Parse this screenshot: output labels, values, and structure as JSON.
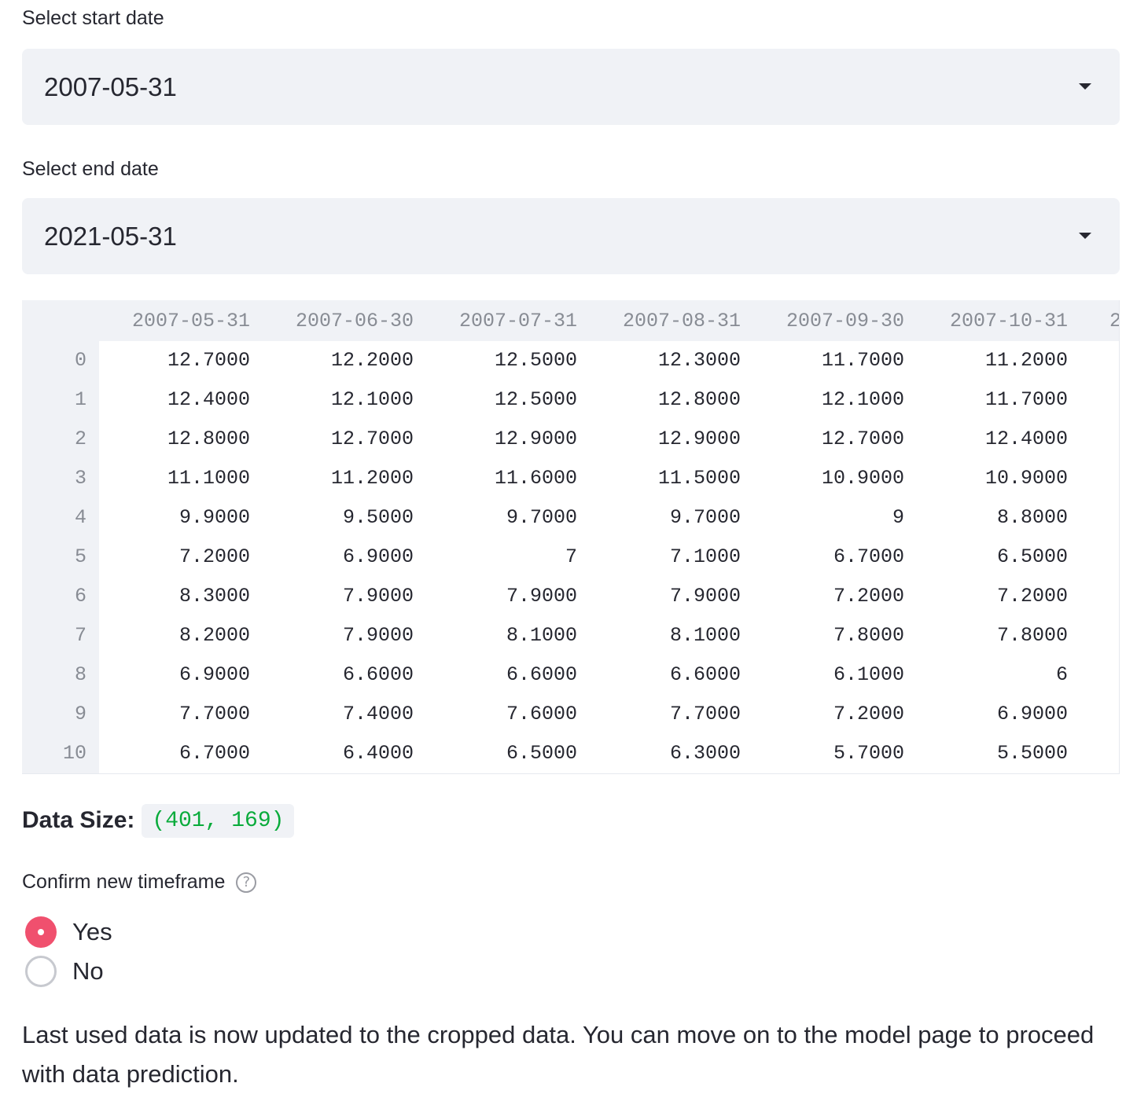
{
  "start_date": {
    "label": "Select start date",
    "value": "2007-05-31"
  },
  "end_date": {
    "label": "Select end date",
    "value": "2021-05-31"
  },
  "dataframe": {
    "columns": [
      "2007-05-31",
      "2007-06-30",
      "2007-07-31",
      "2007-08-31",
      "2007-09-30",
      "2007-10-31",
      "2"
    ],
    "index": [
      "0",
      "1",
      "2",
      "3",
      "4",
      "5",
      "6",
      "7",
      "8",
      "9",
      "10"
    ],
    "rows": [
      [
        "12.7000",
        "12.2000",
        "12.5000",
        "12.3000",
        "11.7000",
        "11.2000"
      ],
      [
        "12.4000",
        "12.1000",
        "12.5000",
        "12.8000",
        "12.1000",
        "11.7000"
      ],
      [
        "12.8000",
        "12.7000",
        "12.9000",
        "12.9000",
        "12.7000",
        "12.4000"
      ],
      [
        "11.1000",
        "11.2000",
        "11.6000",
        "11.5000",
        "10.9000",
        "10.9000"
      ],
      [
        "9.9000",
        "9.5000",
        "9.7000",
        "9.7000",
        "9",
        "8.8000"
      ],
      [
        "7.2000",
        "6.9000",
        "7",
        "7.1000",
        "6.7000",
        "6.5000"
      ],
      [
        "8.3000",
        "7.9000",
        "7.9000",
        "7.9000",
        "7.2000",
        "7.2000"
      ],
      [
        "8.2000",
        "7.9000",
        "8.1000",
        "8.1000",
        "7.8000",
        "7.8000"
      ],
      [
        "6.9000",
        "6.6000",
        "6.6000",
        "6.6000",
        "6.1000",
        "6"
      ],
      [
        "7.7000",
        "7.4000",
        "7.6000",
        "7.7000",
        "7.2000",
        "6.9000"
      ],
      [
        "6.7000",
        "6.4000",
        "6.5000",
        "6.3000",
        "5.7000",
        "5.5000"
      ]
    ]
  },
  "data_size": {
    "label": "Data Size:",
    "value": "(401, 169)"
  },
  "confirm": {
    "label": "Confirm new timeframe",
    "help_icon": "question-circle-icon",
    "options": [
      {
        "label": "Yes",
        "checked": true
      },
      {
        "label": "No",
        "checked": false
      }
    ]
  },
  "message": "Last used data is now updated to the cropped data. You can move on to the model page to proceed with data prediction.",
  "colors": {
    "accent": "#f0506e",
    "code_green": "#09ab3b",
    "widget_bg": "#f0f2f6"
  }
}
